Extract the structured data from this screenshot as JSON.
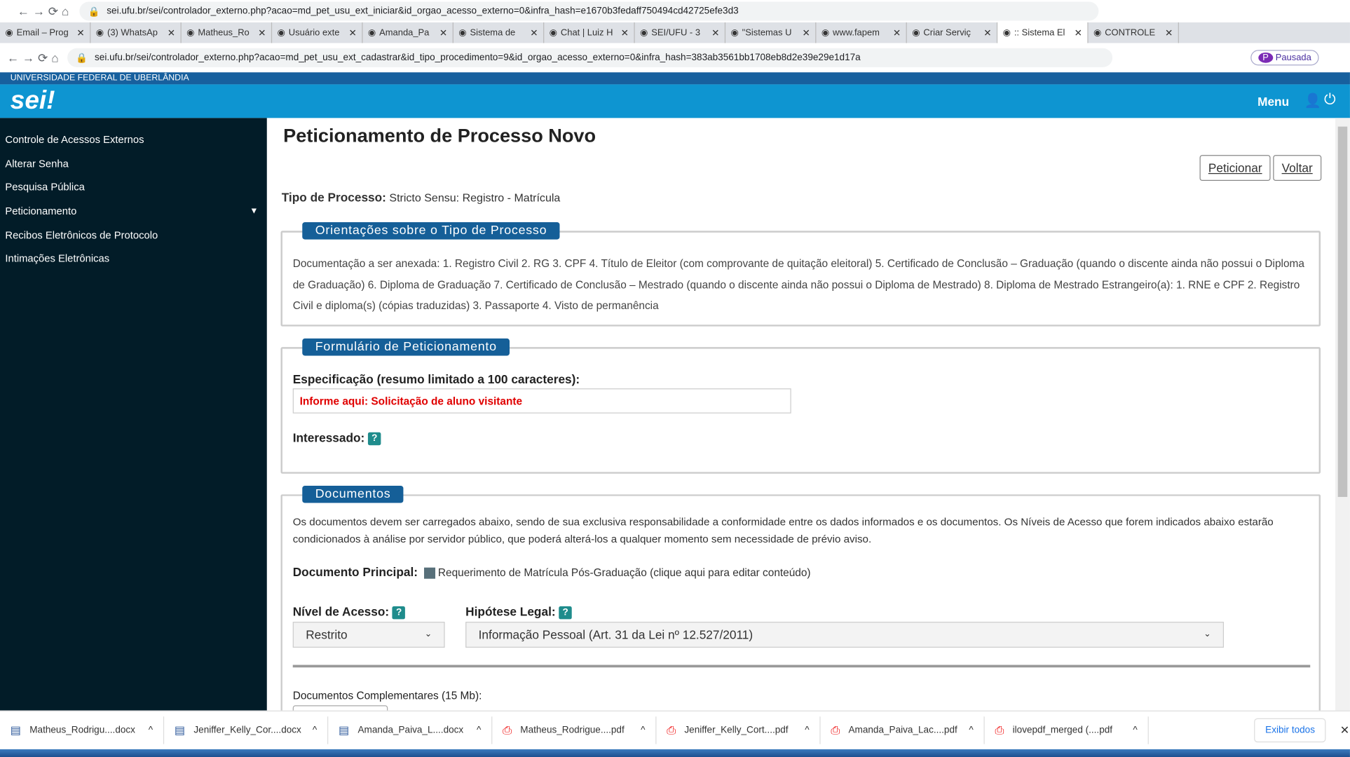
{
  "browser": {
    "url_back": "sei.ufu.br/sei/controlador_externo.php?acao=md_pet_usu_ext_iniciar&id_orgao_acesso_externo=0&infra_hash=e1670b3fedaff750494cd42725efe3d3",
    "url": "sei.ufu.br/sei/controlador_externo.php?acao=md_pet_usu_ext_cadastrar&id_tipo_procedimento=9&id_orgao_acesso_externo=0&infra_hash=383ab3561bb1708eb8d2e39e29e1d17a",
    "profile": "Pausada",
    "tabs": [
      {
        "label": "Email – Prog"
      },
      {
        "label": "(3) WhatsAp"
      },
      {
        "label": "Matheus_Ro"
      },
      {
        "label": "Usuário exte"
      },
      {
        "label": "Amanda_Pa"
      },
      {
        "label": "Sistema de"
      },
      {
        "label": "Chat | Luiz H"
      },
      {
        "label": "SEI/UFU - 3"
      },
      {
        "label": "\"Sistemas U"
      },
      {
        "label": "www.fapem"
      },
      {
        "label": "Criar Serviç"
      },
      {
        "label": ":: Sistema El"
      },
      {
        "label": "CONTROLE"
      }
    ],
    "active_tab": 11
  },
  "header": {
    "university": "UNIVERSIDADE FEDERAL DE UBERLÂNDIA",
    "logo": "sei!",
    "menu": "Menu"
  },
  "sidebar": {
    "items": [
      {
        "label": "Controle de Acessos Externos"
      },
      {
        "label": "Alterar Senha"
      },
      {
        "label": "Pesquisa Pública"
      },
      {
        "label": "Peticionamento"
      },
      {
        "label": "Recibos Eletrônicos de Protocolo"
      },
      {
        "label": "Intimações Eletrônicas"
      }
    ]
  },
  "page": {
    "title": "Peticionamento de Processo Novo",
    "peticionar": "Peticionar",
    "voltar": "Voltar",
    "tipo_label": "Tipo de Processo:",
    "tipo_value": "Stricto Sensu: Registro - Matrícula",
    "orientacoes": {
      "legend": "Orientações sobre o Tipo de Processo",
      "text": "Documentação a ser anexada: 1. Registro Civil 2. RG 3. CPF 4. Título de Eleitor (com comprovante de quitação eleitoral) 5. Certificado de Conclusão – Graduação (quando o discente ainda não possui o Diploma de Graduação) 6. Diploma de Graduação 7. Certificado de Conclusão – Mestrado (quando o discente ainda não possui o Diploma de Mestrado) 8. Diploma de Mestrado Estrangeiro(a): 1. RNE e CPF 2. Registro Civil e diploma(s) (cópias traduzidas) 3. Passaporte 4. Visto de permanência"
    },
    "formulario": {
      "legend": "Formulário de Peticionamento",
      "spec_label": "Especificação (resumo limitado a 100 caracteres):",
      "spec_value": "Informe aqui: Solicitação de aluno visitante",
      "interessado_label": "Interessado:",
      "help": "?"
    },
    "documentos": {
      "legend": "Documentos",
      "text": "Os documentos devem ser carregados abaixo, sendo de sua exclusiva responsabilidade a conformidade entre os dados informados e os documentos. Os Níveis de Acesso que forem indicados abaixo estarão condicionados à análise por servidor público, que poderá alterá-los a qualquer momento sem necessidade de prévio aviso.",
      "principal_label": "Documento Principal:",
      "principal_link": "Requerimento de Matrícula Pós-Graduação (clique aqui para editar conteúdo)",
      "nivel_label": "Nível de Acesso:",
      "nivel_value": "Restrito",
      "hipotese_label": "Hipótese Legal:",
      "hipotese_value": "Informação Pessoal (Art. 31 da Lei nº 12.527/2011)",
      "complementares": "Documentos Complementares (15 Mb):"
    }
  },
  "downloads": {
    "items": [
      {
        "name": "Matheus_Rodrigu....docx",
        "type": "word"
      },
      {
        "name": "Jeniffer_Kelly_Cor....docx",
        "type": "word"
      },
      {
        "name": "Amanda_Paiva_L....docx",
        "type": "word"
      },
      {
        "name": "Matheus_Rodrigue....pdf",
        "type": "pdf"
      },
      {
        "name": "Jeniffer_Kelly_Cort....pdf",
        "type": "pdf"
      },
      {
        "name": "Amanda_Paiva_Lac....pdf",
        "type": "pdf"
      },
      {
        "name": "ilovepdf_merged (....pdf",
        "type": "pdf"
      }
    ],
    "show_all": "Exibir todos"
  },
  "colors": {
    "header": "#0e95d1",
    "sidebar": "#021c28",
    "legend": "#155f98",
    "university_bar": "#17609e",
    "required_text": "#e00000"
  }
}
